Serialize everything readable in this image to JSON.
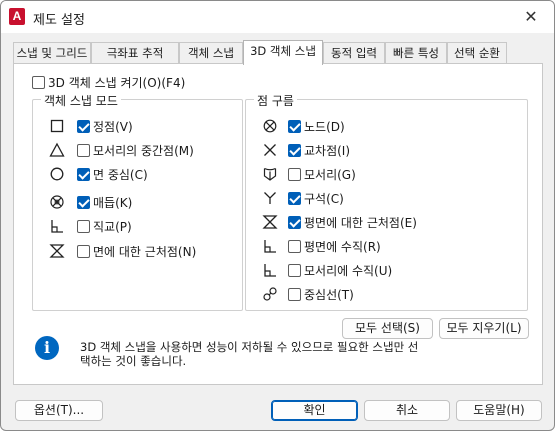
{
  "window": {
    "title": "제도 설정",
    "app_icon_letter": "A",
    "close_glyph": "✕"
  },
  "tabs": [
    {
      "label": "스냅 및 그리드",
      "active": false
    },
    {
      "label": "극좌표 추적",
      "active": false
    },
    {
      "label": "객체 스냅",
      "active": false
    },
    {
      "label": "3D 객체 스냅",
      "active": true
    },
    {
      "label": "동적 입력",
      "active": false
    },
    {
      "label": "빠른 특성",
      "active": false
    },
    {
      "label": "선택 순환",
      "active": false
    }
  ],
  "snap_toggle": {
    "label": "3D 객체 스냅 켜기(O)(F4)",
    "checked": false
  },
  "object_snap_group": {
    "title": "객체 스냅 모드",
    "items": [
      {
        "icon": "square-icon",
        "label": "정점(V)",
        "checked": true
      },
      {
        "icon": "triangle-icon",
        "label": "모서리의 중간점(M)",
        "checked": false
      },
      {
        "icon": "circle-icon",
        "label": "면 중심(C)",
        "checked": true
      },
      {
        "icon": "knot-icon",
        "label": "매듭(K)",
        "checked": true
      },
      {
        "icon": "perpendicular-icon",
        "label": "직교(P)",
        "checked": false
      },
      {
        "icon": "hourglass-icon",
        "label": "면에 대한 근처점(N)",
        "checked": false
      }
    ]
  },
  "point_cloud_group": {
    "title": "점 구름",
    "items": [
      {
        "icon": "node-icon",
        "label": "노드(D)",
        "checked": true
      },
      {
        "icon": "intersection-icon",
        "label": "교차점(I)",
        "checked": true
      },
      {
        "icon": "edge-icon",
        "label": "모서리(G)",
        "checked": false
      },
      {
        "icon": "corner-icon",
        "label": "구석(C)",
        "checked": true
      },
      {
        "icon": "hourglass-icon",
        "label": "평면에 대한 근처점(E)",
        "checked": true
      },
      {
        "icon": "perpendicular-icon",
        "label": "평면에 수직(R)",
        "checked": false
      },
      {
        "icon": "perpendicular-icon",
        "label": "모서리에 수직(U)",
        "checked": false
      },
      {
        "icon": "centerline-icon",
        "label": "중심선(T)",
        "checked": false
      }
    ]
  },
  "actions": {
    "select_all": "모두 선택(S)",
    "clear_all": "모두 지우기(L)"
  },
  "info": {
    "icon": "info-icon",
    "text_line1": "3D 객체 스냅을 사용하면 성능이 저하될 수 있으므로 필요한 스냅만 선",
    "text_line2": "택하는 것이 좋습니다."
  },
  "footer": {
    "options": "옵션(T)...",
    "ok": "확인",
    "cancel": "취소",
    "help": "도움말(H)"
  }
}
